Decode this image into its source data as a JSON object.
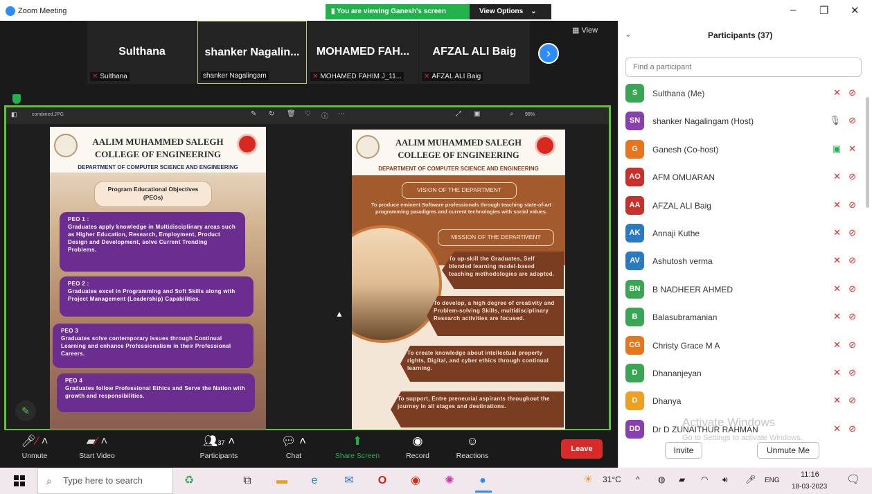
{
  "window": {
    "title": "Zoom Meeting",
    "banner": "You are viewing Ganesh's screen",
    "view_options": "View Options",
    "minimize": "–",
    "restore": "❐",
    "close": "✕"
  },
  "tiles": [
    {
      "name": "Sulthana",
      "label": "Sulthana"
    },
    {
      "name": "shanker  Nagalin...",
      "label": "shanker Nagalingam"
    },
    {
      "name": "MOHAMED  FAH...",
      "label": "MOHAMED FAHIM J_11..."
    },
    {
      "name": "AFZAL ALI Baig",
      "label": "AFZAL ALI Baig"
    }
  ],
  "view_label": "View",
  "viewer": {
    "file": "combined.JPG",
    "zoom": "98%"
  },
  "slide1": {
    "college1": "AALIM MUHAMMED SALEGH",
    "college2": "COLLEGE OF ENGINEERING",
    "dept": "DEPARTMENT OF COMPUTER SCIENCE AND ENGINEERING",
    "peos_title": "Program Educational Objectives (PEOs)",
    "peos": [
      {
        "t": "PEO 1 :",
        "d": "Graduates apply knowledge in Multidisciplinary areas such as Higher Education, Research, Employment, Product Design and Development, solve Current Trending Problems."
      },
      {
        "t": "PEO 2 :",
        "d": "Graduates excel in Programming and Soft Skills along with Project Management (Leadership) Capabilities."
      },
      {
        "t": "PEO 3",
        "d": "Graduates solve contemporary issues through Continual Learning and enhance Professionalism in their Professional Careers."
      },
      {
        "t": "PEO 4",
        "d": "Graduates follow Professional Ethics and Serve the Nation with growth and responsibilities."
      }
    ]
  },
  "slide2": {
    "college1": "AALIM MUHAMMED SALEGH",
    "college2": "COLLEGE OF ENGINEERING",
    "dept": "DEPARTMENT OF COMPUTER SCIENCE AND ENGINEERING",
    "vision_title": "VISION OF THE DEPARTMENT",
    "vision": "To produce eminent Software professionals through teaching state-of-art programming paradigms and current technologies with social values.",
    "mission_title": "MISSION OF THE DEPARTMENT",
    "missions": [
      "To up-skill the Graduates, Self blended learning model-based teaching methodologies are adopted.",
      "To develop, a high degree of creativity and Problem-solving Skills, multidisciplinary Research activities are focused.",
      "To create knowledge about intellectual property rights, Digital, and cyber ethics through continual learning.",
      "To support, Entre preneurial aspirants throughout the journey in all stages and destinations."
    ]
  },
  "toolbar": {
    "unmute": "Unmute",
    "start_video": "Start Video",
    "participants": "Participants",
    "participants_count": "37",
    "chat": "Chat",
    "share_screen": "Share Screen",
    "record": "Record",
    "reactions": "Reactions",
    "leave": "Leave"
  },
  "panel": {
    "title": "Participants (37)",
    "search_placeholder": "Find a participant",
    "participants": [
      {
        "initials": "S",
        "name": "Sulthana (Me)",
        "color": "#3aa655"
      },
      {
        "initials": "SN",
        "name": "shanker Nagalingam (Host)",
        "color": "#8a3fb0"
      },
      {
        "initials": "G",
        "name": "Ganesh (Co-host)",
        "color": "#e8741c"
      },
      {
        "initials": "AO",
        "name": "AFM OMUARAN",
        "color": "#c9302c"
      },
      {
        "initials": "AA",
        "name": "AFZAL ALI Baig",
        "color": "#c9302c"
      },
      {
        "initials": "AK",
        "name": "Annaji Kuthe",
        "color": "#2b79c2"
      },
      {
        "initials": "AV",
        "name": "Ashutosh verma",
        "color": "#2b79c2"
      },
      {
        "initials": "BN",
        "name": "B NADHEER AHMED",
        "color": "#3aa655"
      },
      {
        "initials": "B",
        "name": "Balasubramanian",
        "color": "#3aa655"
      },
      {
        "initials": "CG",
        "name": "Christy Grace M A",
        "color": "#e8741c"
      },
      {
        "initials": "D",
        "name": "Dhananjeyan",
        "color": "#3aa655"
      },
      {
        "initials": "D",
        "name": "Dhanya",
        "color": "#f0a020"
      },
      {
        "initials": "DD",
        "name": "Dr D ZUNAITHUR RAHMAN",
        "color": "#8a3fb0"
      }
    ],
    "invite": "Invite",
    "unmute_me": "Unmute Me",
    "activate1": "Activate Windows",
    "activate2": "Go to Settings to activate Windows."
  },
  "taskbar": {
    "search": "Type here to search",
    "temp": "31°C",
    "lang": "ENG",
    "time": "11:16",
    "date": "18-03-2023"
  }
}
